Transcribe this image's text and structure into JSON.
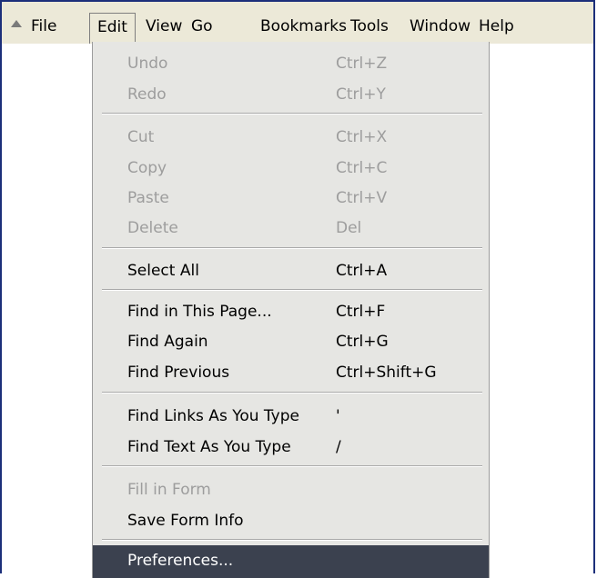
{
  "menubar": {
    "items": [
      "File",
      "Edit",
      "View",
      "Go",
      "Bookmarks",
      "Tools",
      "Window",
      "Help"
    ],
    "open_item": "Edit"
  },
  "edit_menu": {
    "items": [
      {
        "label": "Undo",
        "shortcut": "Ctrl+Z",
        "enabled": false
      },
      {
        "label": "Redo",
        "shortcut": "Ctrl+Y",
        "enabled": false
      },
      {
        "label": "Cut",
        "shortcut": "Ctrl+X",
        "enabled": false
      },
      {
        "label": "Copy",
        "shortcut": "Ctrl+C",
        "enabled": false
      },
      {
        "label": "Paste",
        "shortcut": "Ctrl+V",
        "enabled": false
      },
      {
        "label": "Delete",
        "shortcut": "Del",
        "enabled": false
      },
      {
        "label": "Select All",
        "shortcut": "Ctrl+A",
        "enabled": true
      },
      {
        "label": "Find in This Page...",
        "shortcut": "Ctrl+F",
        "enabled": true
      },
      {
        "label": "Find Again",
        "shortcut": "Ctrl+G",
        "enabled": true
      },
      {
        "label": "Find Previous",
        "shortcut": "Ctrl+Shift+G",
        "enabled": true
      },
      {
        "label": "Find Links As You Type",
        "shortcut": "'",
        "enabled": true
      },
      {
        "label": "Find Text As You Type",
        "shortcut": "/",
        "enabled": true
      },
      {
        "label": "Fill in Form",
        "shortcut": "",
        "enabled": false
      },
      {
        "label": "Save Form Info",
        "shortcut": "",
        "enabled": true
      },
      {
        "label": "Preferences...",
        "shortcut": "",
        "enabled": true,
        "highlighted": true
      }
    ]
  }
}
